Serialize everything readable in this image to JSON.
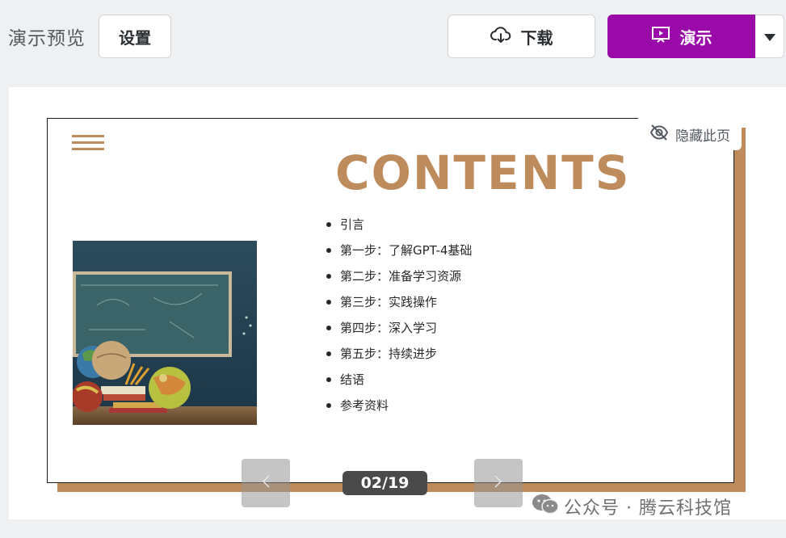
{
  "header": {
    "preview_label": "演示预览",
    "settings_label": "设置",
    "download_label": "下载",
    "present_label": "演示"
  },
  "slide": {
    "hide_page_label": "隐藏此页",
    "title": "CONTENTS",
    "items": [
      "引言",
      "第一步：了解GPT-4基础",
      "第二步：准备学习资源",
      "第三步：实践操作",
      "第四步：深入学习",
      "第五步：持续进步",
      "结语",
      "参考资料"
    ]
  },
  "pager": {
    "counter": "02/19"
  },
  "watermark": {
    "text": "公众号 · 腾云科技馆"
  },
  "colors": {
    "accent": "#9a0aa8",
    "slide_accent": "#be8c5c"
  }
}
